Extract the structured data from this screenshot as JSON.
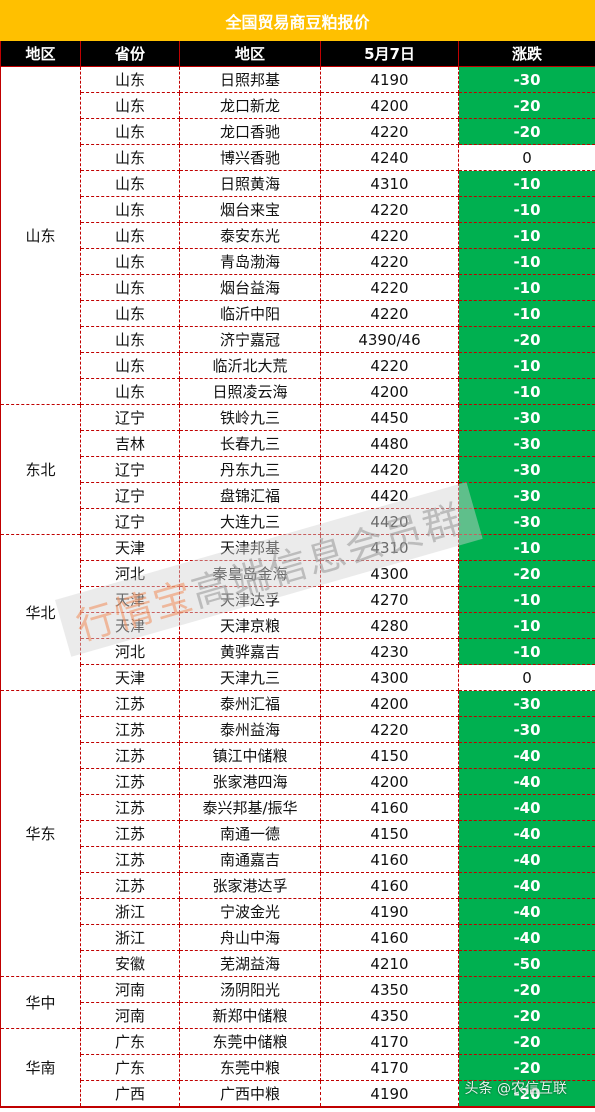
{
  "title": "全国贸易商豆粕报价",
  "headers": [
    "地区",
    "省份",
    "地区",
    "5月7日",
    "涨跌"
  ],
  "colors": {
    "title_band": "#FFC000",
    "header_bg": "#000000",
    "border": "#C00000",
    "down": "#00B050"
  },
  "groups": [
    {
      "region": "山东",
      "rows": [
        [
          "山东",
          "日照邦基",
          "4190",
          "-30"
        ],
        [
          "山东",
          "龙口新龙",
          "4200",
          "-20"
        ],
        [
          "山东",
          "龙口香驰",
          "4220",
          "-20"
        ],
        [
          "山东",
          "博兴香驰",
          "4240",
          "0"
        ],
        [
          "山东",
          "日照黄海",
          "4310",
          "-10"
        ],
        [
          "山东",
          "烟台来宝",
          "4220",
          "-10"
        ],
        [
          "山东",
          "泰安东光",
          "4220",
          "-10"
        ],
        [
          "山东",
          "青岛渤海",
          "4220",
          "-10"
        ],
        [
          "山东",
          "烟台益海",
          "4220",
          "-10"
        ],
        [
          "山东",
          "临沂中阳",
          "4220",
          "-10"
        ],
        [
          "山东",
          "济宁嘉冠",
          "4390/46",
          "-20"
        ],
        [
          "山东",
          "临沂北大荒",
          "4220",
          "-10"
        ],
        [
          "山东",
          "日照凌云海",
          "4200",
          "-10"
        ]
      ]
    },
    {
      "region": "东北",
      "rows": [
        [
          "辽宁",
          "铁岭九三",
          "4450",
          "-30"
        ],
        [
          "吉林",
          "长春九三",
          "4480",
          "-30"
        ],
        [
          "辽宁",
          "丹东九三",
          "4420",
          "-30"
        ],
        [
          "辽宁",
          "盘锦汇福",
          "4420",
          "-30"
        ],
        [
          "辽宁",
          "大连九三",
          "4420",
          "-30"
        ]
      ]
    },
    {
      "region": "华北",
      "rows": [
        [
          "天津",
          "天津邦基",
          "4310",
          "-10"
        ],
        [
          "河北",
          "秦皇岛金海",
          "4300",
          "-20"
        ],
        [
          "天津",
          "天津达孚",
          "4270",
          "-10"
        ],
        [
          "天津",
          "天津京粮",
          "4280",
          "-10"
        ],
        [
          "河北",
          "黄骅嘉吉",
          "4230",
          "-10"
        ],
        [
          "天津",
          "天津九三",
          "4300",
          "0"
        ]
      ]
    },
    {
      "region": "华东",
      "rows": [
        [
          "江苏",
          "泰州汇福",
          "4200",
          "-30"
        ],
        [
          "江苏",
          "泰州益海",
          "4220",
          "-30"
        ],
        [
          "江苏",
          "镇江中储粮",
          "4150",
          "-40"
        ],
        [
          "江苏",
          "张家港四海",
          "4200",
          "-40"
        ],
        [
          "江苏",
          "泰兴邦基/振华",
          "4160",
          "-40"
        ],
        [
          "江苏",
          "南通一德",
          "4150",
          "-40"
        ],
        [
          "江苏",
          "南通嘉吉",
          "4160",
          "-40"
        ],
        [
          "江苏",
          "张家港达孚",
          "4160",
          "-40"
        ],
        [
          "浙江",
          "宁波金光",
          "4190",
          "-40"
        ],
        [
          "浙江",
          "舟山中海",
          "4160",
          "-40"
        ],
        [
          "安徽",
          "芜湖益海",
          "4210",
          "-50"
        ]
      ]
    },
    {
      "region": "华中",
      "rows": [
        [
          "河南",
          "汤阴阳光",
          "4350",
          "-20"
        ],
        [
          "河南",
          "新郑中储粮",
          "4350",
          "-20"
        ]
      ]
    },
    {
      "region": "华南",
      "rows": [
        [
          "广东",
          "东莞中储粮",
          "4170",
          "-20"
        ],
        [
          "广东",
          "东莞中粮",
          "4170",
          "-20"
        ],
        [
          "广西",
          "广西中粮",
          "4190",
          "-20"
        ]
      ]
    }
  ],
  "watermark": {
    "brand": "行情宝",
    "text": "高端信息会员群"
  },
  "corner_watermark": "头条 @农信互联"
}
